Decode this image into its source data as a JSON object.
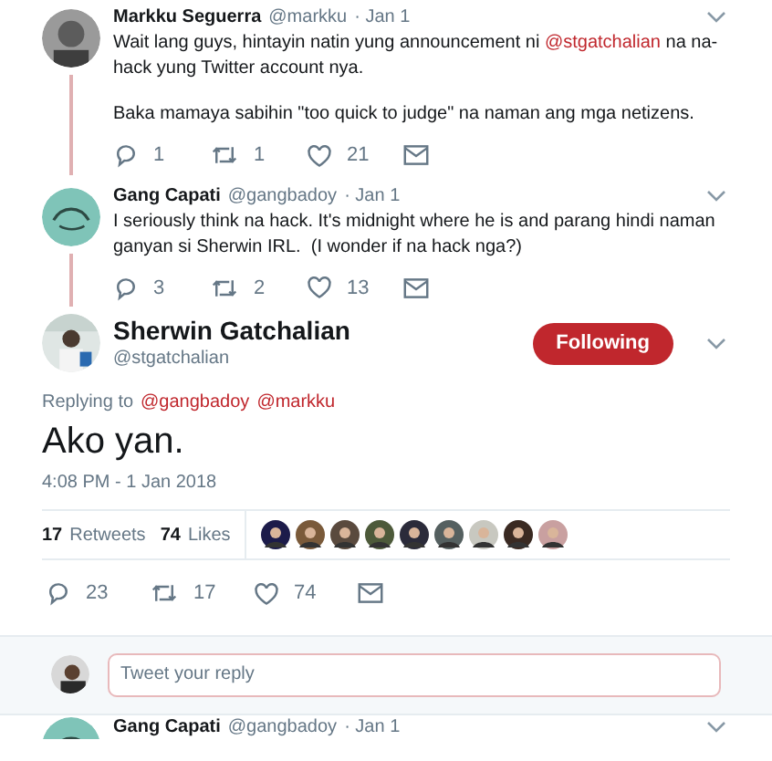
{
  "thread": [
    {
      "name": "Markku Seguerra",
      "handle": "@markku",
      "date": "· Jan 1",
      "paragraphs": [
        "Wait lang guys, hintayin natin yung announcement ni **@stgatchalian** na na-hack yung Twitter account nya.",
        "Baka mamaya sabihin \"too quick to judge\" na naman ang mga netizens."
      ],
      "actions": {
        "replies": "1",
        "retweets": "1",
        "likes": "21"
      }
    },
    {
      "name": "Gang Capati",
      "handle": "@gangbadoy",
      "date": "· Jan 1",
      "paragraphs": [
        "I seriously think na hack. It's midnight where he is and parang hindi naman ganyan si Sherwin IRL.  (I wonder if na hack nga?)"
      ],
      "actions": {
        "replies": "3",
        "retweets": "2",
        "likes": "13"
      }
    }
  ],
  "main_tweet": {
    "name": "Sherwin Gatchalian",
    "handle": "@stgatchalian",
    "follow_button": {
      "label": "Following",
      "selected": true
    },
    "replying_to_label": "Replying to",
    "replying_to": [
      "@gangbadoy",
      "@markku"
    ],
    "text": "Ako yan.",
    "timestamp": "4:08 PM - 1 Jan 2018",
    "retweets_count": "17",
    "retweets_label": "Retweets",
    "likes_count": "74",
    "likes_label": "Likes",
    "actions": {
      "replies": "23",
      "retweets": "17",
      "likes": "74"
    }
  },
  "reply_box": {
    "placeholder": "Tweet your reply"
  },
  "next_tweet": {
    "name": "Gang Capati",
    "handle": "@gangbadoy",
    "date": "· Jan 1"
  }
}
